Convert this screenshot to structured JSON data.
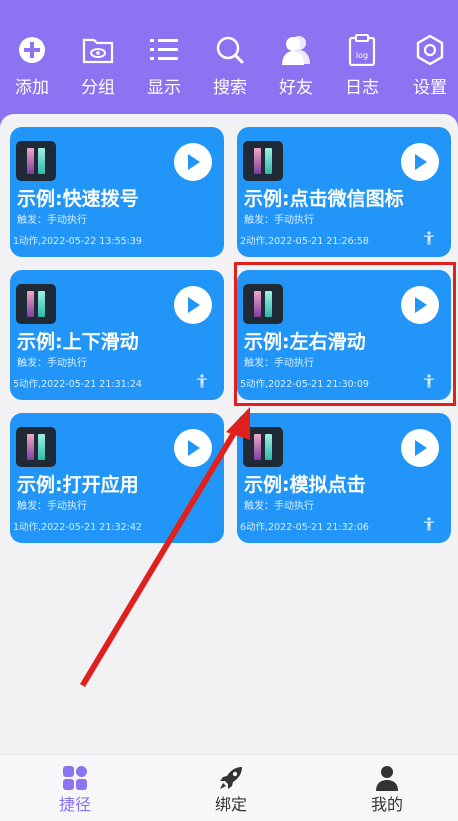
{
  "toolbar": {
    "add": "添加",
    "group": "分组",
    "display": "显示",
    "search": "搜索",
    "friends": "好友",
    "log": "日志",
    "settings": "设置"
  },
  "cards": [
    {
      "title": "示例:快速拨号",
      "trigger": "触发：手动执行",
      "meta": "1动作,2022-05-22 13:55:39"
    },
    {
      "title": "示例:点击微信图标",
      "trigger": "触发：手动执行",
      "meta": "2动作,2022-05-21 21:26:58"
    },
    {
      "title": "示例:上下滑动",
      "trigger": "触发：手动执行",
      "meta": "5动作,2022-05-21 21:31:24"
    },
    {
      "title": "示例:左右滑动",
      "trigger": "触发：手动执行",
      "meta": "5动作,2022-05-21 21:30:09"
    },
    {
      "title": "示例:打开应用",
      "trigger": "触发：手动执行",
      "meta": "1动作,2022-05-21 21:32:42"
    },
    {
      "title": "示例:模拟点击",
      "trigger": "触发：手动执行",
      "meta": "6动作,2022-05-21 21:32:06"
    }
  ],
  "bottom_nav": {
    "shortcuts": "捷径",
    "bind": "绑定",
    "mine": "我的"
  },
  "colors": {
    "header": "#8b73f2",
    "card": "#2196f8",
    "active_tab": "#8b73f2",
    "annotation": "#e0201c"
  }
}
